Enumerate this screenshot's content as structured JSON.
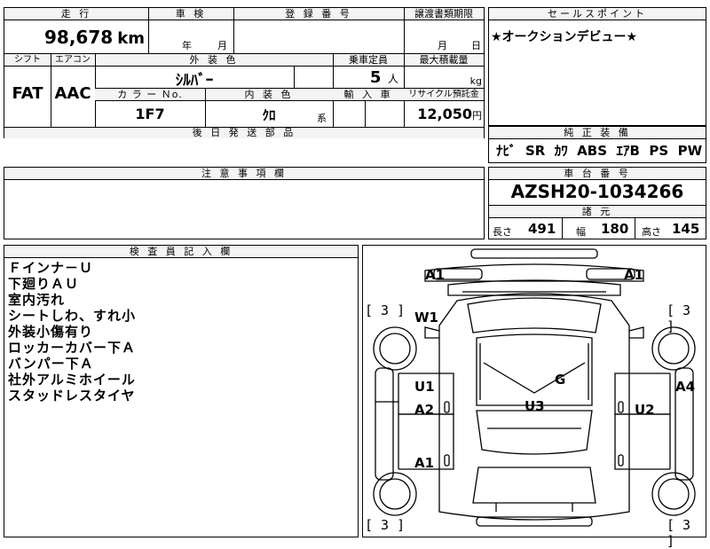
{
  "top": {
    "mileage_label": "走 行",
    "inspection_label": "車 検",
    "registration_label": "登 録 番 号",
    "transfer_doc_label": "譲渡書類期限",
    "mileage_value": "98,678",
    "mileage_unit": "km",
    "year_suffix": "年",
    "month_suffix": "月",
    "transfer_month": "月",
    "transfer_day": "日"
  },
  "row2": {
    "shift_label": "シフト",
    "ac_label": "エアコン",
    "ext_color_label": "外 装 色",
    "capacity_label": "乗車定員",
    "max_load_label": "最大積載量",
    "shift_value": "FAT",
    "ac_value": "AAC",
    "ext_color_value": "ｼﾙﾊﾞｰ",
    "capacity_value": "5",
    "capacity_unit": "人",
    "max_load_unit": "kg",
    "color_no_label": "カ ラ ー Ｎo.",
    "int_color_label": "内 装 色",
    "import_label": "輸 入 車",
    "recycle_label": "リサイクル預託金",
    "color_no_value": "1F7",
    "int_color_value": "ｸﾛ",
    "int_color_suffix": "系",
    "recycle_value": "12,050",
    "recycle_unit": "円",
    "later_parts_label": "後 日 発 送 部 品"
  },
  "sales": {
    "label": "セールスポイント",
    "text": "★オークションデビュー★"
  },
  "equipment": {
    "label": "純 正 装 備",
    "text": "ﾅﾋﾞ  SR  ｶﾜ  ABS  ｴｱB  PS  PW"
  },
  "caution": {
    "label": "注 意 事 項 欄"
  },
  "chassis": {
    "label": "車 台 番 号",
    "value": "AZSH20-1034266",
    "spec_label": "諸 元",
    "length_label": "長さ",
    "length_value": "491",
    "width_label": "幅",
    "width_value": "180",
    "height_label": "高さ",
    "height_value": "145"
  },
  "inspector": {
    "label": "検 査 員 記 入 欄",
    "notes": [
      "Ｆインナ－Ｕ",
      "下廻りＡＵ",
      "室内汚れ",
      "シートしわ、すれ小",
      "外装小傷有り",
      "ロッカーカバー下Ａ",
      "バンパー下Ａ",
      "社外アルミホイール",
      "スタッドレスタイヤ"
    ]
  },
  "diagram": {
    "labels": {
      "front_left": "A1",
      "front_right": "A1",
      "w1": "W1",
      "u1": "U1",
      "a2": "A2",
      "g": "G",
      "u3": "U3",
      "u2": "U2",
      "a4": "A4",
      "rear_left": "A1"
    },
    "tread_fl": "[ 3 ]",
    "tread_fr": "[ 3 ]",
    "tread_rl": "[ 3 ]",
    "tread_rr": "[ 3 ]"
  }
}
